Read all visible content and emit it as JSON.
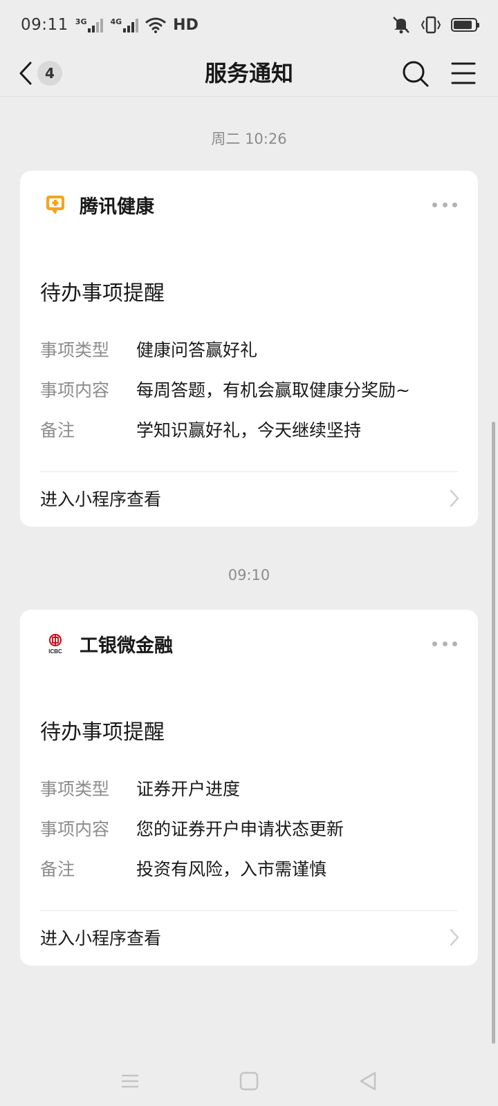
{
  "status_bar": {
    "time": "09:11",
    "net1": "3G",
    "net2": "4G",
    "hd": "HD",
    "icons": [
      "signal-bars-icon",
      "wifi-icon",
      "mute-icon",
      "vibrate-icon",
      "battery-icon"
    ]
  },
  "nav": {
    "back_count": "4",
    "title": "服务通知",
    "icons": [
      "back-chevron-icon",
      "search-icon",
      "menu-icon"
    ]
  },
  "messages": [
    {
      "timestamp": "周二 10:26",
      "app_name": "腾讯健康",
      "app_logo": "tencent-health-icon",
      "title": "待办事项提醒",
      "rows": [
        {
          "label": "事项类型",
          "value": "健康问答赢好礼"
        },
        {
          "label": "事项内容",
          "value": "每周答题，有机会赢取健康分奖励~"
        },
        {
          "label": "备注",
          "value": "学知识赢好礼，今天继续坚持"
        }
      ],
      "link": "进入小程序查看"
    },
    {
      "timestamp": "09:10",
      "app_name": "工银微金融",
      "app_logo": "icbc-icon",
      "logo_text": "ICBC",
      "title": "待办事项提醒",
      "rows": [
        {
          "label": "事项类型",
          "value": "证券开户进度"
        },
        {
          "label": "事项内容",
          "value": "您的证券开户申请状态更新"
        },
        {
          "label": "备注",
          "value": "投资有风险，入市需谨慎"
        }
      ],
      "link": "进入小程序查看"
    }
  ],
  "system_nav": [
    "recents-icon",
    "home-icon",
    "back-triangle-icon"
  ],
  "colors": {
    "background": "#ededed",
    "card": "#ffffff",
    "text_primary": "#191919",
    "text_secondary": "#8c8c8c",
    "tencent_health_orange": "#f5a41b",
    "icbc_red": "#c7000b"
  }
}
